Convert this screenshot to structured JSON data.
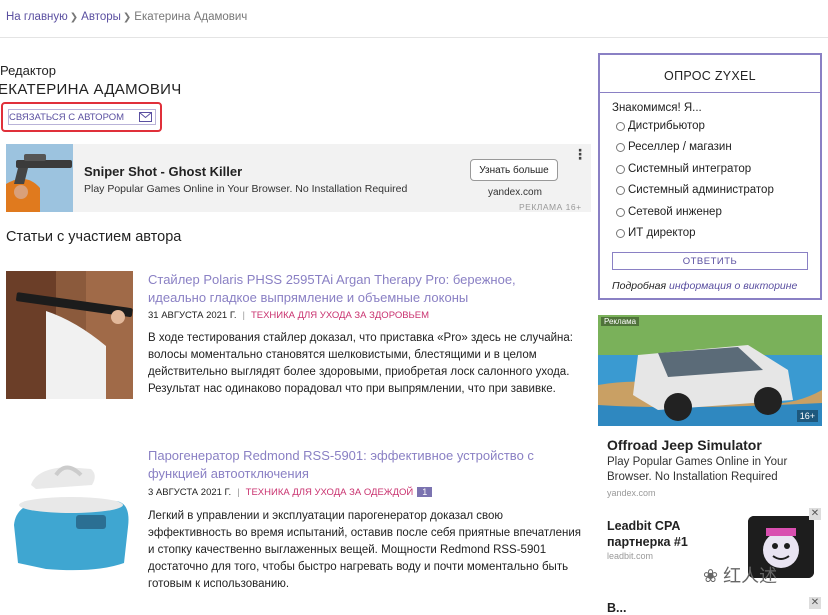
{
  "breadcrumb": {
    "home": "На главную",
    "authors": "Авторы",
    "current": "Екатерина Адамович"
  },
  "author": {
    "role": "Редактор",
    "name": "ЕКАТЕРИНА АДАМОВИЧ",
    "contact_label": "СВЯЗАТЬСЯ С АВТОРОМ"
  },
  "ad": {
    "title": "Sniper Shot - Ghost Killer",
    "description": "Play Popular Games Online in Your Browser. No Installation Required",
    "button": "Узнать больше",
    "domain": "yandex.com",
    "label": "РЕКЛАМА",
    "age": "16+"
  },
  "section_heading": "Статьи с участием автора",
  "articles": [
    {
      "title": "Стайлер Polaris PHSS 2595TAi Argan Therapy Pro: бережное, идеально гладкое выпрямление и объемные локоны",
      "date": "31 АВГУСТА 2021 Г.",
      "category": "ТЕХНИКА ДЛЯ УХОДА ЗА ЗДОРОВЬЕМ",
      "badge": "",
      "text": "В ходе тестирования стайлер доказал, что приставка «Pro» здесь не случайна: волосы моментально становятся шелковистыми, блестящими и в целом действительно выглядят более здоровыми, приобретая лоск салонного ухода. Результат нас одинаково порадовал что при выпрямлении, что при завивке."
    },
    {
      "title": "Парогенератор Redmond RSS-5901: эффективное устройство с функцией автоотключения",
      "date": "3 АВГУСТА 2021 Г.",
      "category": "ТЕХНИКА ДЛЯ УХОДА ЗА ОДЕЖДОЙ",
      "badge": "1",
      "text": "Легкий в управлении и эксплуатации парогенератор доказал свою эффективность во время испытаний, оставив после себя приятные впечатления и стопку качественно выглаженных вещей. Мощности Redmond RSS-5901 достаточно для того, чтобы быстро нагревать воду и почти моментально быть готовым к использованию."
    }
  ],
  "poll": {
    "title": "ОПРОС ZYXEL",
    "question": "Знакомимся! Я...",
    "options": [
      "Дистрибьютор",
      "Реселлер / магазин",
      "Системный интегратор",
      "Системный администратор",
      "Сетевой инженер",
      "ИТ директор"
    ],
    "button": "ОТВЕТИТЬ",
    "footer_text": "Подробная",
    "footer_link": "информация о викторине"
  },
  "right_ads": {
    "tag": "Реклама",
    "age": "16+",
    "ad1_title": "Offroad Jeep Simulator",
    "ad1_desc": "Play Popular Games Online in Your Browser. No Installation Required",
    "ad1_domain": "yandex.com",
    "ad2_title": "Leadbit CPA партнерка #1",
    "ad2_domain": "leadbit.com",
    "ad3_title_partial": "В..."
  },
  "watermark": "红人述"
}
